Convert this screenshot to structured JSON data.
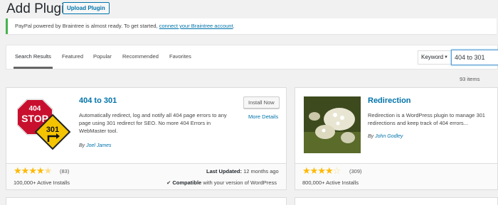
{
  "header": {
    "title": "Add Plugins",
    "upload_label": "Upload Plugin"
  },
  "notice": {
    "text": "PayPal powered by Braintree is almost ready. To get started, ",
    "link": "connect your Braintree account",
    "suffix": "."
  },
  "tabs": [
    {
      "label": "Search Results"
    },
    {
      "label": "Featured"
    },
    {
      "label": "Popular"
    },
    {
      "label": "Recommended"
    },
    {
      "label": "Favorites"
    }
  ],
  "search": {
    "type_label": "Keyword",
    "value": "404 to 301"
  },
  "items_count": "93 items",
  "plugins": [
    {
      "name": "404 to 301",
      "description": "Automatically redirect, log and notify all 404 page errors to any page using 301 redirect for SEO. No more 404 Errors in WebMaster tool.",
      "by": "By",
      "author": "Joel James",
      "install_label": "Install Now",
      "more_details": "More Details",
      "rating": 4.5,
      "rating_count": "(83)",
      "installs": "100,000+ Active Installs",
      "last_updated_label": "Last Updated:",
      "last_updated": "12 months ago",
      "compat_check": "✔",
      "compat_bold": "Compatible",
      "compat_text": "with your version of WordPress",
      "sign_text_top": "404",
      "sign_text_stop": "STOP",
      "sign_text_301": "301"
    },
    {
      "name": "Redirection",
      "description": "Redirection is a WordPress plugin to manage 301 redirections and keep track of 404 errors...",
      "by": "By",
      "author": "John Godley",
      "rating": 4,
      "rating_count": "(309)",
      "installs": "800,000+ Active Installs"
    }
  ],
  "colors": {
    "link": "#0073aa",
    "star": "#ffb900",
    "notice_border": "#46b450"
  }
}
